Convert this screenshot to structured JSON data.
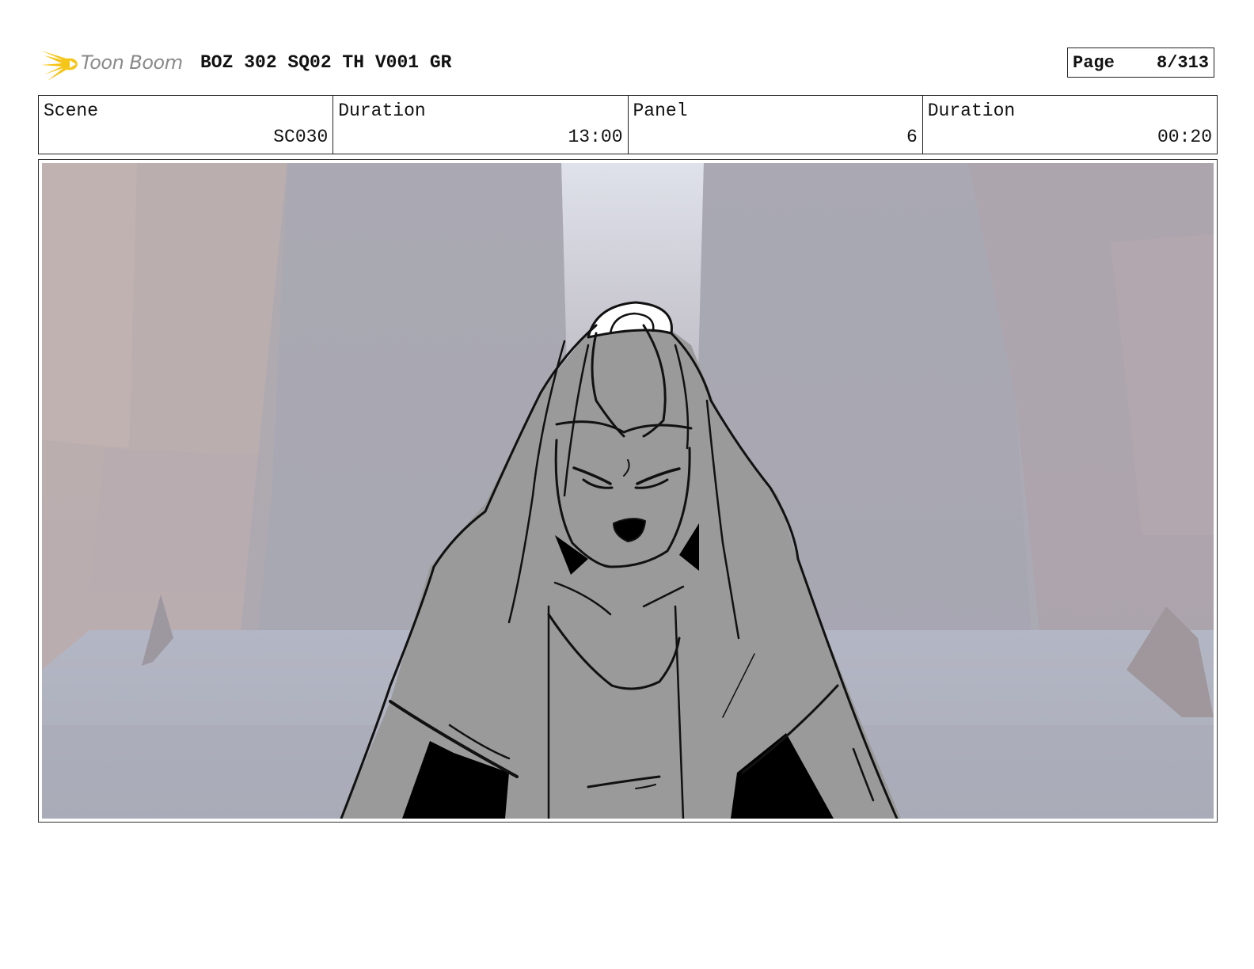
{
  "header": {
    "logo_text": "Toon Boom",
    "title": "BOZ 302 SQ02 TH V001 GR",
    "page_label": "Page",
    "page_value": "8/313"
  },
  "info": {
    "scene_label": "Scene",
    "scene_value": "SC030",
    "scene_duration_label": "Duration",
    "scene_duration_value": "13:00",
    "panel_label": "Panel",
    "panel_value": "6",
    "panel_duration_label": "Duration",
    "panel_duration_value": "00:20"
  },
  "colors": {
    "logo_star": "#f5c518",
    "logo_text": "#8a8a8a",
    "figure_fill": "#999999",
    "line": "#111111"
  }
}
